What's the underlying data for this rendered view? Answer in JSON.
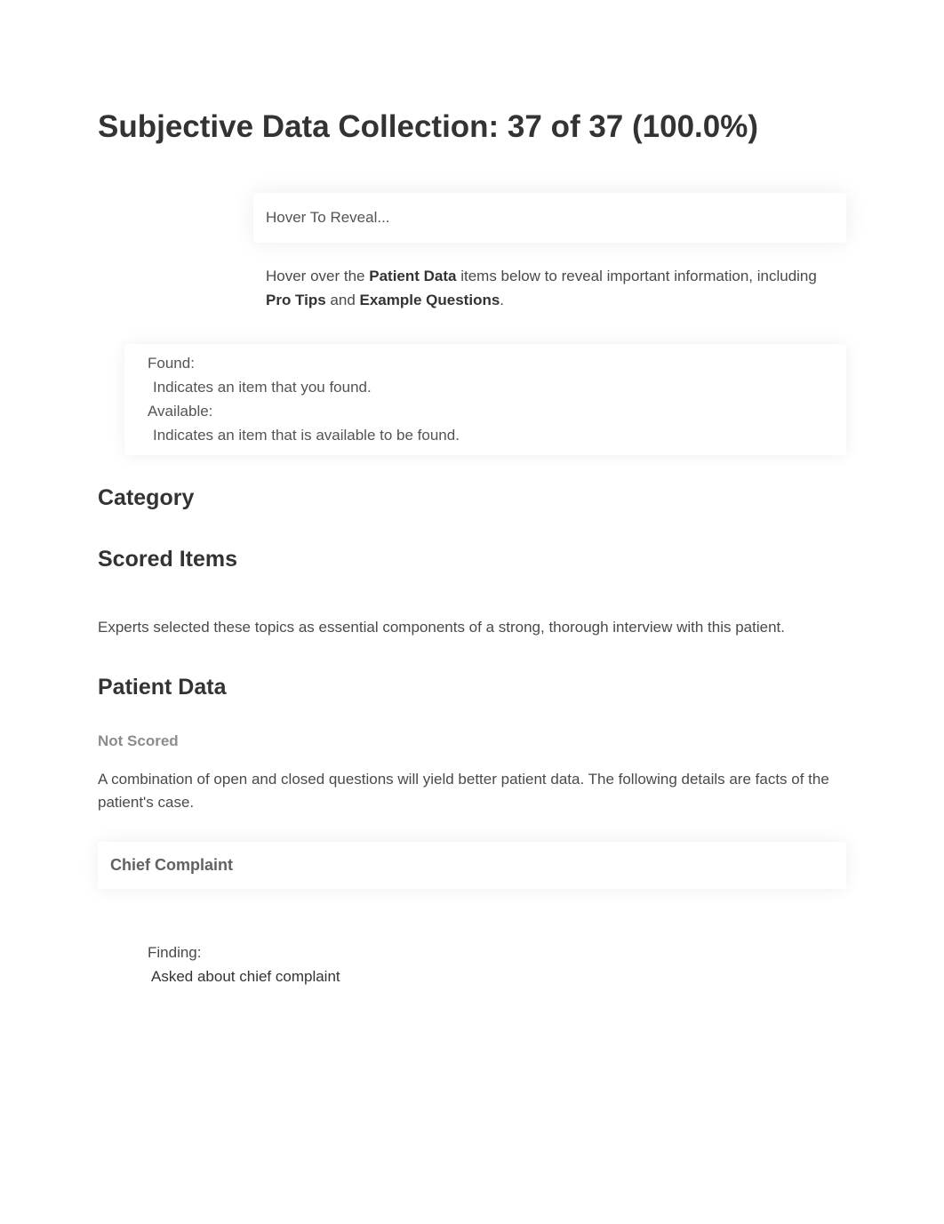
{
  "title": "Subjective Data Collection: 37 of 37 (100.0%)",
  "hover_box": "Hover To Reveal...",
  "hover_desc_prefix": "Hover over the ",
  "hover_desc_bold1": "Patient Data",
  "hover_desc_mid1": " items below to reveal important information, including ",
  "hover_desc_bold2": "Pro Tips",
  "hover_desc_mid2": " and ",
  "hover_desc_bold3": "Example Questions",
  "hover_desc_end": ".",
  "legend": {
    "found_label": "Found:",
    "found_text": "Indicates an item that you found.",
    "available_label": "Available:",
    "available_text": "Indicates an item that is available to be found."
  },
  "category_heading": "Category",
  "scored_items_heading": "Scored Items",
  "scored_items_desc": "Experts selected these topics as essential components of a strong, thorough interview with this patient.",
  "patient_data_heading": "Patient Data",
  "not_scored": "Not Scored",
  "patient_data_desc": "A combination of open and closed questions will yield better patient data. The following details are facts of the patient's case.",
  "chief_complaint_heading": "Chief Complaint",
  "finding_label": "Finding:",
  "finding_value": "Asked about chief complaint"
}
